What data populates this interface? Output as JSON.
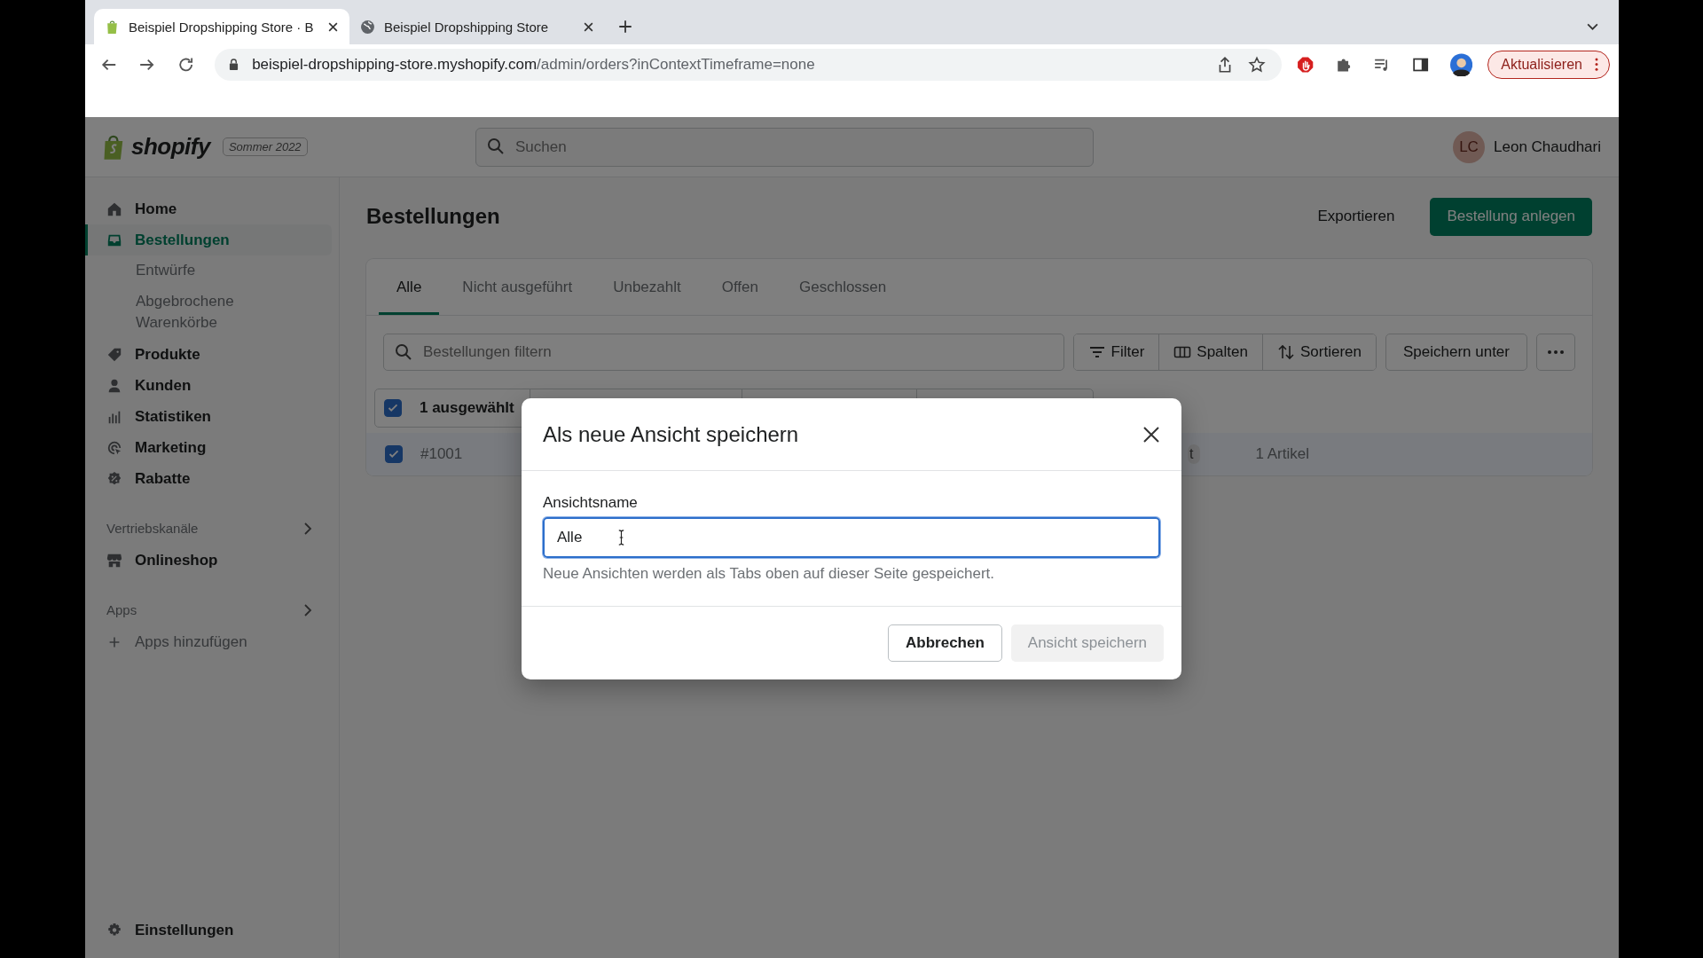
{
  "browser": {
    "tabs": [
      {
        "title": "Beispiel Dropshipping Store · B",
        "selected": true
      },
      {
        "title": "Beispiel Dropshipping Store",
        "selected": false
      }
    ],
    "url_host": "beispiel-dropshipping-store.myshopify.com",
    "url_path": "/admin/orders?inContextTimeframe=none",
    "update_button": "Aktualisieren"
  },
  "header": {
    "logo": "shopify",
    "edition_badge": "Sommer 2022",
    "search_placeholder": "Suchen",
    "user": {
      "initials": "LC",
      "name": "Leon Chaudhari"
    }
  },
  "sidebar": {
    "items": [
      {
        "label": "Home",
        "selected": false
      },
      {
        "label": "Bestellungen",
        "selected": true,
        "children": [
          {
            "label": "Entwürfe",
            "selected": false
          },
          {
            "label": "Abgebrochene Warenkörbe",
            "selected": false
          }
        ]
      },
      {
        "label": "Produkte",
        "selected": false
      },
      {
        "label": "Kunden",
        "selected": false
      },
      {
        "label": "Statistiken",
        "selected": false
      },
      {
        "label": "Marketing",
        "selected": false
      },
      {
        "label": "Rabatte",
        "selected": false
      }
    ],
    "sections": [
      {
        "title": "Vertriebskanäle",
        "items": [
          {
            "label": "Onlineshop",
            "kind": "link"
          }
        ]
      },
      {
        "title": "Apps",
        "items": [
          {
            "label": "Apps hinzufügen",
            "kind": "add"
          }
        ]
      }
    ],
    "settings": "Einstellungen"
  },
  "page": {
    "title": "Bestellungen",
    "export_button": "Exportieren",
    "primary_button": "Bestellung anlegen",
    "tabs": [
      {
        "label": "Alle",
        "selected": true
      },
      {
        "label": "Nicht ausgeführt",
        "selected": false
      },
      {
        "label": "Unbezahlt",
        "selected": false
      },
      {
        "label": "Offen",
        "selected": false
      },
      {
        "label": "Geschlossen",
        "selected": false
      }
    ],
    "filter_placeholder": "Bestellungen filtern",
    "filter_buttons": [
      "Filter",
      "Spalten",
      "Sortieren"
    ],
    "save_as_button": "Speichern unter",
    "bulk": {
      "checked": true,
      "label": "1 ausgewählt"
    },
    "rows": [
      {
        "checked": true,
        "order": "#1001",
        "status": "t",
        "items": "1 Artikel"
      }
    ]
  },
  "modal": {
    "title": "Als neue Ansicht speichern",
    "label": "Ansichtsname",
    "value": "Alle",
    "help": "Neue Ansichten werden als Tabs oben auf dieser Seite gespeichert.",
    "cancel": "Abbrechen",
    "save": "Ansicht speichern",
    "save_disabled": true
  }
}
